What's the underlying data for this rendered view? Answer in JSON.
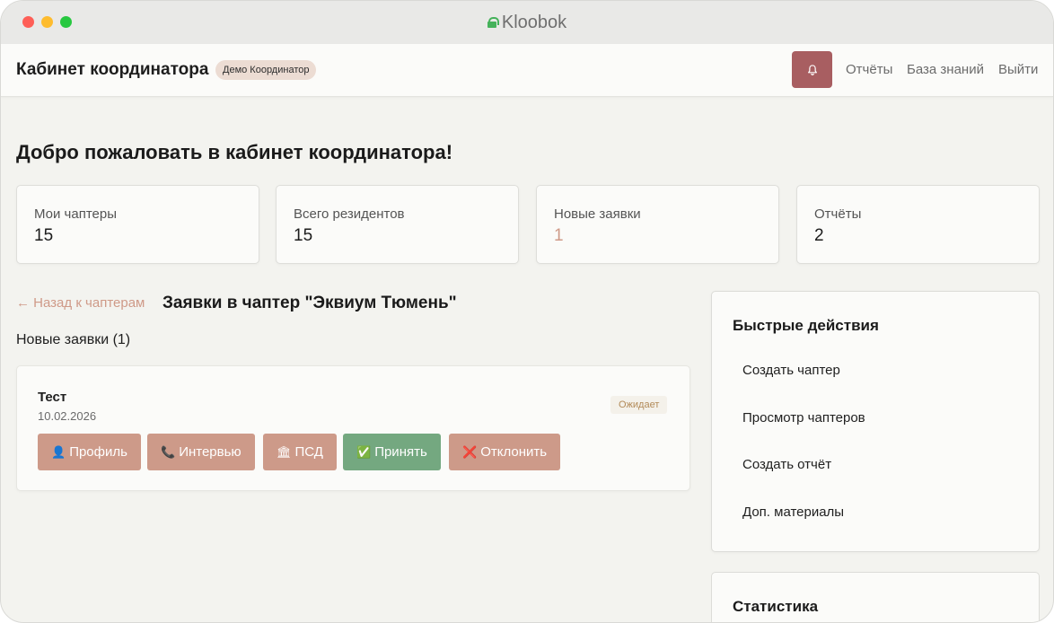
{
  "window": {
    "title": "Kloobok"
  },
  "header": {
    "brand": "Кабинет координатора",
    "user_badge": "Демо Координатор",
    "nav": [
      "Отчёты",
      "База знаний",
      "Выйти"
    ]
  },
  "welcome": "Добро пожаловать в кабинет координатора!",
  "stats": [
    {
      "label": "Мои чаптеры",
      "value": "15"
    },
    {
      "label": "Всего резидентов",
      "value": "15"
    },
    {
      "label": "Новые заявки",
      "value": "1"
    },
    {
      "label": "Отчёты",
      "value": "2"
    }
  ],
  "applications": {
    "back_link": "← Назад к чаптерам",
    "title": "Заявки в чаптер \"Эквиум Тюмень\"",
    "subtitle": "Новые заявки (1)",
    "items": [
      {
        "name": "Тест",
        "date": "10.02.2026",
        "status": "Ожидает",
        "actions": {
          "profile": {
            "icon": "👤",
            "label": "Профиль"
          },
          "interview": {
            "icon": "📞",
            "label": "Интервью"
          },
          "psd": {
            "icon": "🏛",
            "label": "ПСД"
          },
          "accept": {
            "icon": "✅",
            "label": "Принять"
          },
          "reject": {
            "icon": "❌",
            "label": "Отклонить"
          }
        }
      }
    ]
  },
  "quick_actions": {
    "title": "Быстрые действия",
    "items": [
      "Создать чаптер",
      "Просмотр чаптеров",
      "Создать отчёт",
      "Доп. материалы"
    ]
  },
  "statistics": {
    "title": "Статистика"
  },
  "colors": {
    "accent": "#cd9a89",
    "accept": "#74a880",
    "bell": "#a85e61",
    "pending": "#b28a58"
  }
}
